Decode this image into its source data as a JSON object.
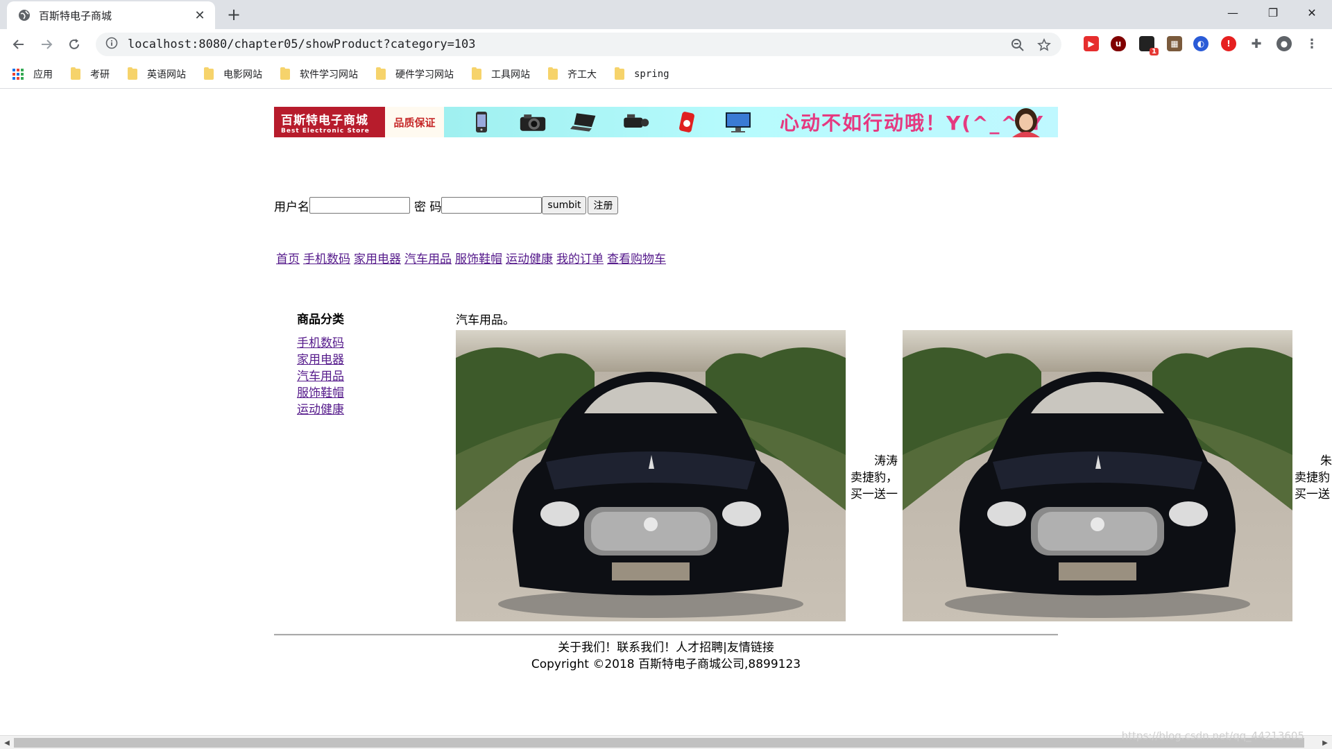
{
  "browser": {
    "tab_title": "百斯特电子商城",
    "tab_close": "✕",
    "new_tab": "+",
    "url": "localhost:8080/chapter05/showProduct?category=103",
    "window_controls": {
      "minimize": "—",
      "restore": "❐",
      "close": "✕"
    },
    "bookmarks": [
      "应用",
      "考研",
      "英语网站",
      "电影网站",
      "软件学习网站",
      "硬件学习网站",
      "工具网站",
      "齐工大",
      "spring"
    ],
    "extension_badge": "1"
  },
  "banner": {
    "logo_line1": "百斯特电子商城",
    "logo_line2": "Best Electronic Store",
    "quality": "品质保证",
    "slogan": "心动不如行动哦！Y(^_^)Y"
  },
  "login": {
    "username_label": "用户名",
    "password_label": " 密 码",
    "submit_label": "sumbit",
    "register_label": "注册"
  },
  "nav": {
    "items": [
      "首页",
      "手机数码",
      "家用电器",
      "汽车用品",
      "服饰鞋帽",
      "运动健康",
      "我的订单",
      "查看购物车"
    ]
  },
  "sidebar": {
    "heading": "商品分类",
    "items": [
      "手机数码",
      "家用电器",
      "汽车用品",
      "服饰鞋帽",
      "运动健康"
    ]
  },
  "section": {
    "title": "汽车用品。"
  },
  "products": [
    {
      "seller": "涛涛",
      "line2": "卖捷豹，",
      "line3": "买一送一"
    },
    {
      "seller": "朱",
      "line2": "卖捷豹",
      "line3": "买一送"
    }
  ],
  "footer": {
    "links": "关于我们！联系我们！人才招聘|友情链接",
    "copyright": "Copyright ©2018 百斯特电子商城公司,8899123"
  },
  "watermark": "https://blog.csdn.net/qq_44213605",
  "colors": {
    "link_visited": "#551a8b",
    "banner_red": "#b71c2c",
    "slogan_pink": "#e53980"
  }
}
